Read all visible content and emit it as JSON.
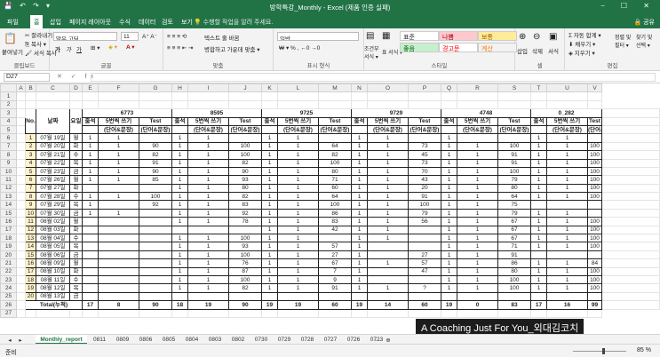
{
  "window": {
    "title": "방학특강_Monthly - Excel (제품 인증 실패)",
    "controls": "⎯ ☐ ✕"
  },
  "quickaccess": "💾 ↶ ↷ ▾",
  "menu": {
    "items": [
      "파일",
      "홈",
      "삽입",
      "페이지 레이아웃",
      "수식",
      "데이터",
      "검토",
      "보기"
    ],
    "tell": "💡 수행할 작업을 알려 주세요.",
    "share": "🔒 공유"
  },
  "ribbon": {
    "clipboard": {
      "label": "클립보드",
      "paste": "붙여넣기",
      "cut": "✂ 잘라내기",
      "copy": "⎘ 복사 ▾",
      "format": "🖌 서식 복사"
    },
    "font": {
      "label": "글꼴",
      "name": "맑은 고딕",
      "size": "11",
      "bold": "가",
      "italic": "가",
      "underline": "가"
    },
    "alignment": {
      "label": "맞춤",
      "wrap": "텍스트 줄 바꿈",
      "merge": "병합하고 가운데 맞춤 ▾"
    },
    "number": {
      "label": "표시 형식",
      "format": "일반"
    },
    "styles": {
      "label": "스타일",
      "cond": "조건부 서식 ▾",
      "table": "표 서식 ▾",
      "items": [
        {
          "text": "표준",
          "bg": "#ffffff",
          "fg": "#222222"
        },
        {
          "text": "나쁨",
          "bg": "#ffc7ce",
          "fg": "#9c0006"
        },
        {
          "text": "보통",
          "bg": "#ffeb9c",
          "fg": "#9c5700"
        },
        {
          "text": "좋음",
          "bg": "#c6efce",
          "fg": "#006100"
        },
        {
          "text": "경고문",
          "bg": "#ffffff",
          "fg": "#ff0000"
        },
        {
          "text": "계산",
          "bg": "#f2f2f2",
          "fg": "#fa7d00"
        }
      ]
    },
    "cells": {
      "label": "셀",
      "insert": "삽입",
      "delete": "삭제",
      "format": "서식"
    },
    "editing": {
      "label": "편집",
      "autosum": "Σ 자동 합계 ▾",
      "fill": "⬇ 채우기 ▾",
      "clear": "◈ 지우기 ▾",
      "sort": "정렬 및 필터 ▾",
      "find": "찾기 및 선택 ▾"
    }
  },
  "formula": {
    "namebox": "D27",
    "fx": "✕ ✓ fx",
    "value": ""
  },
  "grid": {
    "col_headers": [
      "",
      "A",
      "B",
      "C",
      "D",
      "E",
      "F",
      "G",
      "H",
      "I",
      "J",
      "K",
      "L",
      "M",
      "N",
      "O",
      "P",
      "Q",
      "R",
      "S",
      "T",
      "U",
      "V"
    ],
    "row_numbers": [
      "1",
      "2",
      "3",
      "4",
      "5",
      "6",
      "7",
      "8",
      "9",
      "10",
      "11",
      "12",
      "13",
      "14",
      "15",
      "16",
      "17",
      "18",
      "19",
      "20",
      "21",
      "22",
      "23",
      "24",
      "25",
      "26"
    ],
    "groups": [
      {
        "title": "6773",
        "text_underline": true
      },
      {
        "title": "8595"
      },
      {
        "title": "9725"
      },
      {
        "title": "9729"
      },
      {
        "title": "4748"
      },
      {
        "title": "0_282"
      }
    ],
    "header_no": "No.",
    "header_date": "날짜",
    "header_day": "요일",
    "sub_headers": [
      "출석",
      "5번씩 쓰기",
      "Test"
    ],
    "sub_headers2": [
      "",
      "(단어&문장)",
      "(단어&문장)"
    ],
    "rows": [
      {
        "no": "1",
        "date": "07월 19일",
        "day": "월",
        "vals": [
          "1",
          "1",
          "",
          "1",
          "1",
          "",
          "1",
          "1",
          "",
          "1",
          "1",
          "",
          "1",
          "",
          "",
          "1",
          "1",
          ""
        ]
      },
      {
        "no": "2",
        "date": "07월 20일",
        "day": "화",
        "vals": [
          "1",
          "1",
          "90",
          "1",
          "1",
          "100",
          "1",
          "1",
          "64",
          "1",
          "1",
          "73",
          "1",
          "1",
          "100",
          "1",
          "1",
          "100"
        ]
      },
      {
        "no": "3",
        "date": "07월 21일",
        "day": "수",
        "vals": [
          "1",
          "1",
          "82",
          "1",
          "1",
          "100",
          "1",
          "1",
          "82",
          "1",
          "1",
          "45",
          "1",
          "1",
          "91",
          "1",
          "1",
          "100"
        ]
      },
      {
        "no": "4",
        "date": "07월 22일",
        "day": "목",
        "vals": [
          "1",
          "1",
          "91",
          "1",
          "1",
          "82",
          "1",
          "1",
          "100",
          "1",
          "1",
          "73",
          "1",
          "1",
          "91",
          "1",
          "1",
          "100"
        ]
      },
      {
        "no": "5",
        "date": "07월 23일",
        "day": "금",
        "vals": [
          "1",
          "1",
          "90",
          "1",
          "1",
          "90",
          "1",
          "1",
          "80",
          "1",
          "1",
          "70",
          "1",
          "1",
          "100",
          "1",
          "1",
          "100"
        ]
      },
      {
        "no": "6",
        "date": "07월 26일",
        "day": "월",
        "vals": [
          "1",
          "1",
          "85",
          "1",
          "1",
          "93",
          "1",
          "1",
          "71",
          "1",
          "1",
          "43",
          "1",
          "1",
          "79",
          "1",
          "1",
          "100"
        ]
      },
      {
        "no": "7",
        "date": "07월 27일",
        "day": "화",
        "vals": [
          "",
          "",
          "",
          "1",
          "1",
          "80",
          "1",
          "1",
          "60",
          "1",
          "1",
          "20",
          "1",
          "1",
          "80",
          "1",
          "1",
          "100"
        ]
      },
      {
        "no": "8",
        "date": "07월 28일",
        "day": "수",
        "vals": [
          "1",
          "1",
          "100",
          "1",
          "1",
          "82",
          "1",
          "1",
          "64",
          "1",
          "1",
          "91",
          "1",
          "1",
          "64",
          "1",
          "1",
          "100"
        ]
      },
      {
        "no": "9",
        "date": "07월 29일",
        "day": "목",
        "vals": [
          "1",
          "",
          "92",
          "1",
          "1",
          "83",
          "1",
          "1",
          "100",
          "1",
          "1",
          "100",
          "1",
          "1",
          "75",
          "",
          "",
          ""
        ]
      },
      {
        "no": "10",
        "date": "07월 30일",
        "day": "금",
        "vals": [
          "1",
          "1",
          "",
          "1",
          "1",
          "92",
          "1",
          "1",
          "86",
          "1",
          "1",
          "79",
          "1",
          "1",
          "79",
          "1",
          "1",
          ""
        ]
      },
      {
        "no": "11",
        "date": "08월 02일",
        "day": "월",
        "vals": [
          "",
          "",
          "",
          "1",
          "1",
          "78",
          "1",
          "1",
          "83",
          "1",
          "1",
          "56",
          "1",
          "1",
          "67",
          "1",
          "1",
          "100"
        ]
      },
      {
        "no": "12",
        "date": "08월 03일",
        "day": "화",
        "vals": [
          "",
          "",
          "",
          "",
          "",
          "",
          "1",
          "1",
          "42",
          "1",
          "1",
          "",
          "1",
          "1",
          "67",
          "1",
          "1",
          "100"
        ]
      },
      {
        "no": "13",
        "date": "08월 04일",
        "day": "수",
        "vals": [
          "",
          "",
          "",
          "1",
          "1",
          "100",
          "1",
          "1",
          "",
          "1",
          "1",
          "",
          "1",
          "1",
          "67",
          "1",
          "1",
          "100"
        ]
      },
      {
        "no": "14",
        "date": "08월 05일",
        "day": "목",
        "vals": [
          "",
          "",
          "",
          "1",
          "1",
          "93",
          "1",
          "1",
          "57",
          "1",
          "",
          "",
          "1",
          "1",
          "71",
          "1",
          "1",
          "100"
        ]
      },
      {
        "no": "15",
        "date": "08월 06일",
        "day": "금",
        "vals": [
          "",
          "",
          "",
          "1",
          "1",
          "100",
          "1",
          "1",
          "27",
          "1",
          "",
          "27",
          "1",
          "1",
          "91",
          "",
          "",
          ""
        ]
      },
      {
        "no": "16",
        "date": "08월 09일",
        "day": "월",
        "vals": [
          "",
          "",
          "",
          "1",
          "1",
          "76",
          "1",
          "1",
          "67",
          "1",
          "1",
          "57",
          "1",
          "1",
          "86",
          "1",
          "1",
          "84"
        ]
      },
      {
        "no": "17",
        "date": "08월 10일",
        "day": "화",
        "vals": [
          "",
          "",
          "",
          "1",
          "1",
          "87",
          "1",
          "1",
          "7",
          "1",
          "",
          "47",
          "1",
          "1",
          "80",
          "1",
          "1",
          "100"
        ]
      },
      {
        "no": "18",
        "date": "08월 11일",
        "day": "수",
        "vals": [
          "",
          "",
          "",
          "1",
          "1",
          "100",
          "1",
          "1",
          "9",
          "1",
          "",
          "",
          "1",
          "1",
          "100",
          "1",
          "1",
          "100"
        ]
      },
      {
        "no": "19",
        "date": "08월 12일",
        "day": "목",
        "vals": [
          "",
          "",
          "",
          "1",
          "1",
          "82",
          "1",
          "1",
          "91",
          "1",
          "1",
          "?",
          "1",
          "1",
          "100",
          "1",
          "1",
          "100"
        ]
      },
      {
        "no": "20",
        "date": "08월 13일",
        "day": "금",
        "vals": [
          "",
          "",
          "",
          "",
          "",
          "",
          "",
          "",
          "",
          "",
          "",
          "",
          "",
          "",
          "",
          "",
          "",
          ""
        ]
      }
    ],
    "total": {
      "label": "Total(누적)",
      "vals": [
        "17",
        "8",
        "90",
        "18",
        "19",
        "90",
        "19",
        "19",
        "60",
        "19",
        "14",
        "60",
        "19",
        "0",
        "83",
        "17",
        "16",
        "99"
      ]
    }
  },
  "sheets": [
    "Monthly_report",
    "0811",
    "0809",
    "0806",
    "0805",
    "0804",
    "0803",
    "0802",
    "0730",
    "0729",
    "0728",
    "0727",
    "0726",
    "0723"
  ],
  "sheet_more": "…",
  "status": {
    "left": "준비",
    "zoom": "85 %"
  },
  "watermark": "A Coaching Just For You_외대김코치",
  "colors": {
    "accent": "#217346"
  }
}
